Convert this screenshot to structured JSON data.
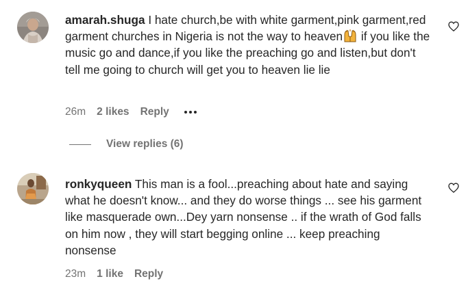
{
  "comments": [
    {
      "username": "amarah.shuga",
      "text_before_emoji": "I hate church,be with white garment,pink garment,red garment churches in Nigeria is not the way to heaven",
      "emoji": "praising-hands-emoji",
      "text_after_emoji": " if you like the music go and dance,if you like the preaching go and listen,but don't tell me going to church will get you to heaven lie lie",
      "time": "26m",
      "likes": "2 likes",
      "reply": "Reply",
      "view_replies": "View replies (6)"
    },
    {
      "username": "ronkyqueen",
      "text": "This man is a fool...preaching about hate and saying what he doesn't know... and they do worse things ... see his garment like masquerade own...Dey yarn nonsense .. if the wrath of God falls on him now , they will start begging online ... keep preaching nonsense",
      "time": "23m",
      "likes": "1 like",
      "reply": "Reply"
    }
  ],
  "colors": {
    "text": "#262626",
    "secondary": "#737373",
    "background": "#ffffff"
  },
  "icons": {
    "like": "heart-outline-icon",
    "more": "more-horizontal-icon"
  }
}
